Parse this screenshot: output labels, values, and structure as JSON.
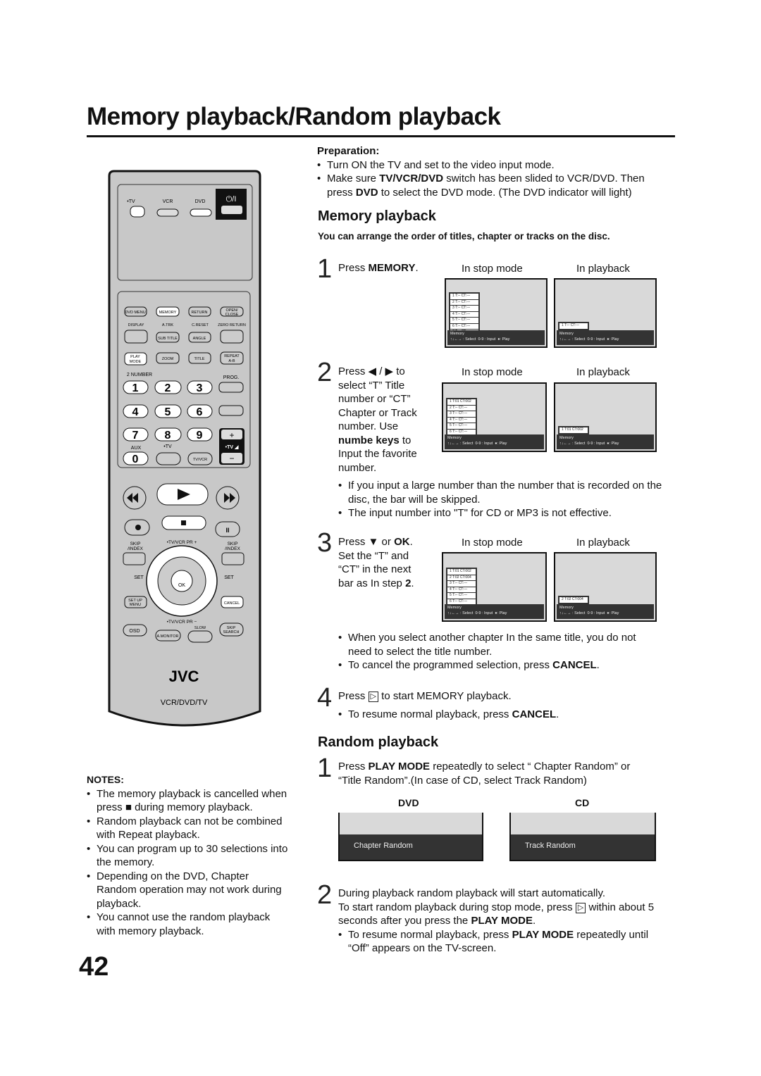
{
  "title": "Memory playback/Random playback",
  "preparation": {
    "heading": "Preparation:",
    "b1": "Turn ON the TV and set to the video input mode.",
    "b2a": "Make sure ",
    "b2b": "TV/VCR/DVD",
    "b2c": " switch has been slided to VCR/DVD. Then press ",
    "b2d": "DVD",
    "b2e": " to select the DVD mode. (The DVD indicator will light)"
  },
  "memory": {
    "heading": "Memory playback",
    "intro": "You can arrange the order of titles, chapter or tracks on the disc.",
    "col_stop": "In stop mode",
    "col_play": "In playback",
    "step1": {
      "num": "1",
      "a": "Press ",
      "b": "MEMORY",
      "c": "."
    },
    "step2": {
      "num": "2",
      "a": "Press ",
      "arrows": "◀ / ▶",
      "b": " to select “T” Title number or “CT” Chapter or Track number. Use ",
      "c": "numbe keys",
      "d": " to Input the favorite number.",
      "bullets": [
        "If you input a large number than the number that is recorded on the disc, the bar will be skipped.",
        "The input number into \"T\" for CD or MP3 is not effective."
      ]
    },
    "step3": {
      "num": "3",
      "a": "Press ",
      "arrow": "▼",
      "b": " or ",
      "c": "OK",
      "d": ". Set the “T” and “CT” in the next bar as In step ",
      "e": "2",
      "f": ".",
      "b1": "When you select another chapter In the same title, you do not need to select the title number.",
      "b2a": "To cancel the programmed selection, press ",
      "b2b": "CANCEL",
      "b2c": "."
    },
    "step4": {
      "num": "4",
      "a": "Press ",
      "play": "▷",
      "b": " to start MEMORY playback.",
      "b1a": "To resume normal playback, press ",
      "b1b": "CANCEL",
      "b1c": "."
    },
    "screen_legend": {
      "title": "Memory",
      "select": "↑↓←→ : Select",
      "input": "0-9 : Input",
      "play": ": Play"
    },
    "screens": [
      {
        "rows": [
          "1 T:-- CT:---",
          "2 T:-- CT:---",
          "3 T:-- CT:---",
          "4 T:-- CT:---",
          "5 T:-- CT:---",
          "6 T:-- CT:---",
          "7 T:-- CT:---"
        ]
      },
      {
        "rows": [
          "1 T:-- CT:---"
        ]
      },
      {
        "rows": [
          "1 T:01 CT:002",
          "2 T:-- CT:---",
          "3 T:-- CT:---",
          "4 T:-- CT:---",
          "5 T:-- CT:---",
          "6 T:-- CT:---",
          "7 T:-- CT:---"
        ]
      },
      {
        "rows": [
          "1 T:01 CT:002"
        ]
      },
      {
        "rows": [
          "1 T:01 CT:002",
          "2 T:02 CT:004",
          "3 T:-- CT:---",
          "4 T:-- CT:---",
          "5 T:-- CT:---",
          "6 T:-- CT:---",
          "7 T:-- CT:---"
        ]
      },
      {
        "rows": [
          "2 T:02 CT:004"
        ]
      }
    ]
  },
  "random": {
    "heading": "Random playback",
    "step1": {
      "num": "1",
      "a": "Press ",
      "b": "PLAY MODE",
      "c": " repeatedly to select “ Chapter Random” or “Title Random”.(In case of CD, select Track Random)"
    },
    "dvd_label": "DVD",
    "cd_label": "CD",
    "dvd_screen": "Chapter Random",
    "cd_screen": "Track Random",
    "step2": {
      "num": "2",
      "l1": "During playback random playback will start automatically.",
      "l2a": "To start random playback during stop mode, press ",
      "play": "▷",
      "l2b": " within about 5 seconds after you press the ",
      "l2c": "PLAY MODE",
      "l2d": ".",
      "b1a": "To resume normal playback, press ",
      "b1b": "PLAY MODE",
      "b1c": " repeatedly until “Off” appears on the TV-screen."
    }
  },
  "notes": {
    "heading": "NOTES:",
    "b1a": "The memory playback is cancelled when press ",
    "stop": "■",
    "b1b": " during memory playback.",
    "b2": "Random playback can not be combined with Repeat playback.",
    "b3": "You can program up to 30 selections into the memory.",
    "b4": "Depending on the DVD, Chapter Random operation may not work during playback.",
    "b5": "You cannot use the random playback with memory playback."
  },
  "page_number": "42",
  "remote": {
    "tv": "•TV",
    "vcr": "VCR",
    "dvd": "DVD",
    "power": "⏻/I",
    "dvd_menu": "DVD MENU",
    "memory": "MEMORY",
    "return": "RETURN",
    "open1": "OPEN/",
    "open2": "CLOSE",
    "display": "DISPLAY",
    "atrk": "A.TRK",
    "creset": "C.RESET",
    "zero": "ZERO RETURN",
    "subtitle": "SUB TITLE",
    "angle": "ANGLE",
    "play1": "PLAY",
    "play2": "MODE",
    "zoom": "ZOOM",
    "title": "TITLE",
    "rep1": "REPEAT",
    "rep2": "A-B",
    "number": "2 NUMBER",
    "prog": "PROG.",
    "keys": [
      "1",
      "2",
      "3",
      "4",
      "5",
      "6",
      "7",
      "8",
      "9",
      "0"
    ],
    "aux": "AUX",
    "tv2": "•TV",
    "tvvcr": "TV/VCR",
    "tvvol": "•TV ◢",
    "plus": "+",
    "minus": "−",
    "skip": "SKIP",
    "index": "/INDEX",
    "pr_up": "•TV/VCR PR +",
    "pr_dn": "•TV/VCR PR −",
    "set": "SET",
    "ok": "OK",
    "setup1": "SET UP",
    "setup2": "MENU",
    "cancel": "CANCEL",
    "osd": "OSD",
    "amon": "A.MONITOR",
    "slow": "SLOW",
    "ss1": "SKIP",
    "ss2": "SEARCH",
    "brand": "JVC",
    "model": "VCR/DVD/TV"
  }
}
